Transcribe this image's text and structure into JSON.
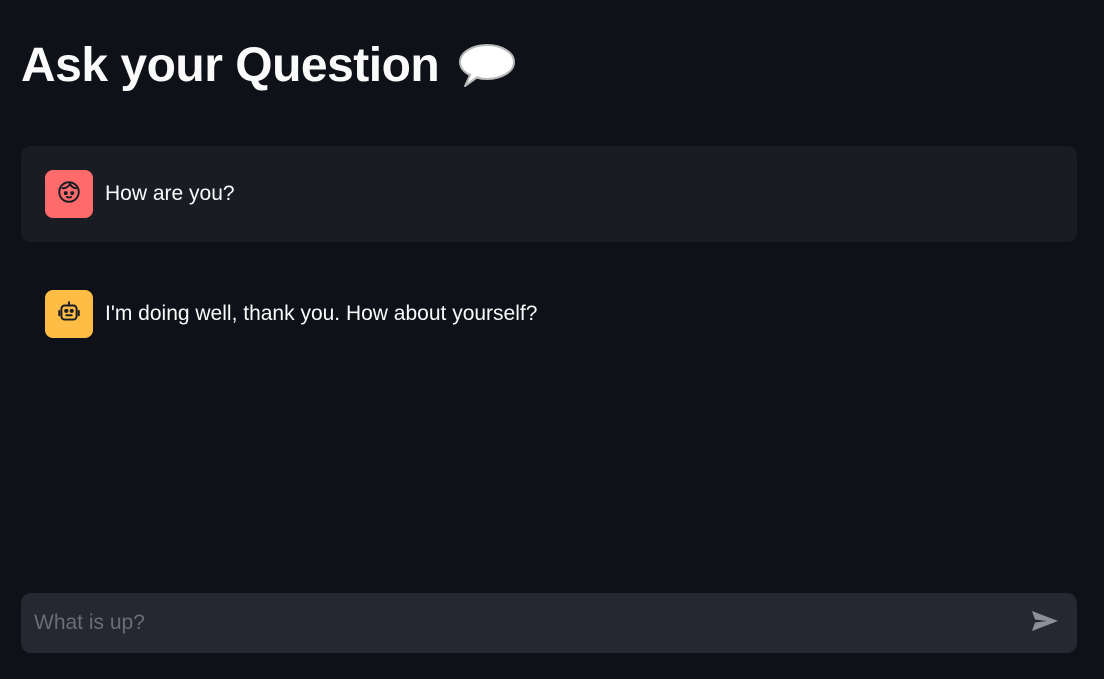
{
  "header": {
    "title": "Ask your Question",
    "emoji_icon": "speech-balloon-icon"
  },
  "messages": [
    {
      "role": "user",
      "avatar_icon": "user-face-icon",
      "avatar_color": "#ff6b6b",
      "text": "How are you?"
    },
    {
      "role": "assistant",
      "avatar_icon": "robot-icon",
      "avatar_color": "#ffbd45",
      "text": "I'm doing well, thank you. How about yourself?"
    }
  ],
  "chat_input": {
    "placeholder": "What is up?",
    "value": "",
    "send_icon": "send-icon"
  },
  "colors": {
    "background": "#0e1117",
    "user_message_bg": "#1a1c24",
    "input_bg": "#262730",
    "text": "#fafafa"
  }
}
